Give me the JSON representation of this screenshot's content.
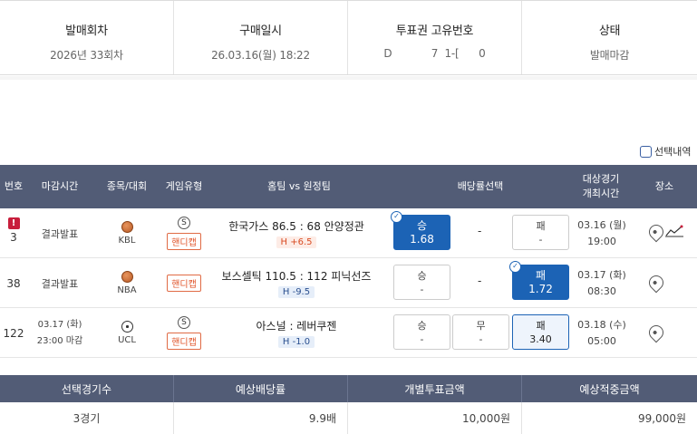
{
  "info": {
    "headers": [
      "발매회차",
      "구매일시",
      "투표권 고유번호",
      "상태"
    ],
    "values": [
      "2026년 33회차",
      "26.03.16(월) 18:22",
      "D            7  1-[      0",
      "발매마감"
    ]
  },
  "legend": {
    "label": "선택내역"
  },
  "table": {
    "headers": {
      "no": "번호",
      "deadline": "마감시간",
      "sport": "종목/대회",
      "gametype": "게임유형",
      "teams": "홈팀 vs 원정팀",
      "odds": "배당률선택",
      "gametime": "대상경기\n개최시간",
      "venue": "장소"
    },
    "rows": [
      {
        "no": "3",
        "alert": "!",
        "deadline": "결과발표",
        "sport_label": "KBL",
        "sport_icon": "basketball-icon",
        "type_mark": "S",
        "type_label": "핸디캡",
        "match": "한국가스 86.5 : 68 안양정관",
        "handicap": "H +6.5",
        "win": {
          "label": "승",
          "value": "1.68"
        },
        "draw": "-",
        "lose": {
          "label": "패",
          "value": "-"
        },
        "date": "03.16 (월)",
        "time": "19:00"
      },
      {
        "no": "38",
        "deadline": "결과발표",
        "sport_label": "NBA",
        "sport_icon": "basketball-icon",
        "type_label": "핸디캡",
        "match": "보스셀틱 110.5 : 112 피닉선즈",
        "handicap": "H -9.5",
        "win": {
          "label": "승",
          "value": "-"
        },
        "draw": "-",
        "lose": {
          "label": "패",
          "value": "1.72"
        },
        "date": "03.17 (화)",
        "time": "08:30"
      },
      {
        "no": "122",
        "deadline_date": "03.17 (화)",
        "deadline_time": "23:00 마감",
        "sport_label": "UCL",
        "sport_icon": "soccer-ball-icon",
        "type_mark": "S",
        "type_label": "핸디캡",
        "match": "아스널 : 레버쿠젠",
        "handicap": "H -1.0",
        "win": {
          "label": "승",
          "value": "-"
        },
        "draw": {
          "label": "무",
          "value": "-"
        },
        "lose": {
          "label": "패",
          "value": "3.40"
        },
        "date": "03.18 (수)",
        "time": "05:00"
      }
    ]
  },
  "summary": {
    "headers": [
      "선택경기수",
      "예상배당률",
      "개별투표금액",
      "예상적중금액"
    ],
    "values": [
      "3경기",
      "9.9배",
      "10,000원",
      "99,000원"
    ]
  },
  "colors": {
    "header_bg": "#525c76",
    "selected": "#1c63b5",
    "handicap": "#e0552b",
    "alert": "#c81e3c"
  }
}
